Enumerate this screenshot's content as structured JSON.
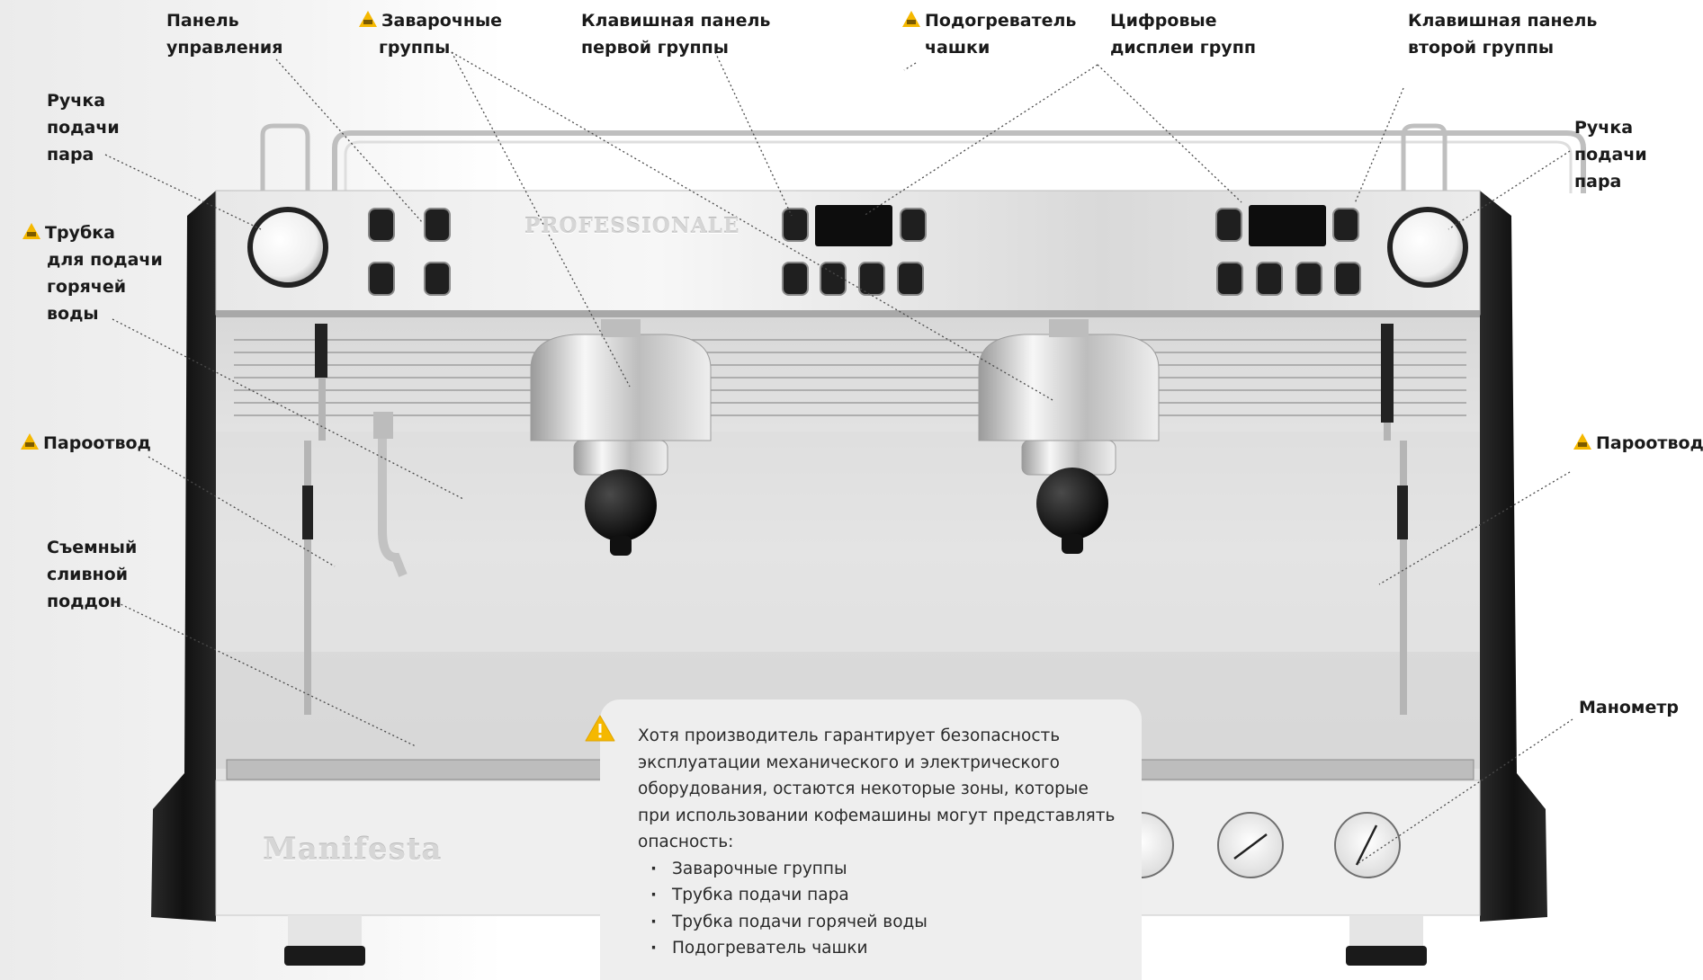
{
  "colors": {
    "accent_warning": "#f5b800",
    "machine_black": "#1b1b1b",
    "steel": "#c9c9c9",
    "notice_bg": "#eeeeee"
  },
  "icons": [
    "warning-triangle-icon"
  ],
  "callouts": {
    "control_panel": [
      "Панель",
      "управления"
    ],
    "brew_groups": [
      "Заварочные",
      "группы"
    ],
    "keypad_first_group": [
      "Клавишная панель",
      "первой группы"
    ],
    "cup_warmer": [
      "Подогреватель",
      "чашки"
    ],
    "digital_displays": [
      "Цифровые",
      "дисплеи групп"
    ],
    "keypad_second_group": [
      "Клавишная панель",
      "второй группы"
    ],
    "steam_knob_left": [
      "Ручка",
      "подачи",
      "пара"
    ],
    "steam_knob_right": [
      "Ручка",
      "подачи",
      "пара"
    ],
    "hot_water_tube": [
      "Трубка",
      "для подачи",
      "горячей",
      "воды"
    ],
    "steam_wand_left": [
      "Пароотвод"
    ],
    "steam_wand_right": [
      "Пароотвод"
    ],
    "drip_tray": [
      "Съемный",
      "сливной",
      "поддон"
    ],
    "manometer": [
      "Манометр"
    ]
  },
  "brand": {
    "panel_text": "PROFESSIONALE",
    "body_text": "Manifesta"
  },
  "notice": {
    "text": "Хотя производитель гарантирует безопасность эксплуатации механического и электрического оборудования, остаются некоторые зоны, которые при использовании кофемашины могут представлять опасность:",
    "items": [
      "Заварочные группы",
      "Трубка подачи пара",
      "Трубка подачи горячей воды",
      "Подогреватель чашки"
    ]
  }
}
